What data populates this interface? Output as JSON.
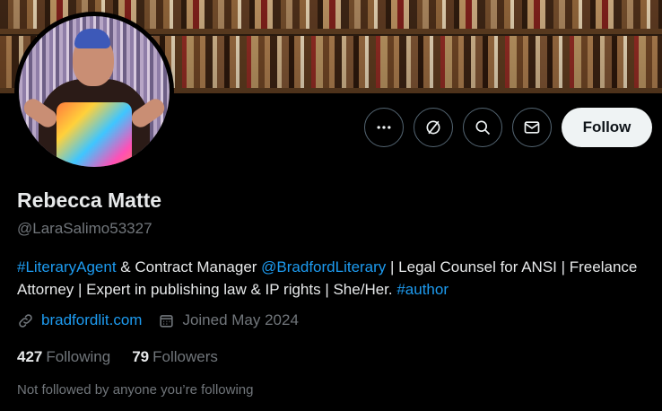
{
  "profile": {
    "name": "Rebecca Matte",
    "handle": "@LaraSalimo53327",
    "bio": {
      "tag1": "#LiteraryAgent",
      "text1": " & Contract Manager ",
      "mention": "@BradfordLiterary",
      "text2": " | Legal Counsel for ANSI | Freelance Attorney | Expert in publishing law & IP rights | She/Her. ",
      "tag2": "#author"
    },
    "website": "bradfordlit.com",
    "joined": "Joined May 2024",
    "following_count": "427",
    "following_label": "Following",
    "followers_count": "79",
    "followers_label": "Followers",
    "not_followed_text": "Not followed by anyone you’re following"
  },
  "actions": {
    "more_icon": "more-horizontal-icon",
    "grok_icon": "grok-icon",
    "search_icon": "search-icon",
    "message_icon": "mail-icon",
    "follow_label": "Follow"
  },
  "colors": {
    "background": "#000000",
    "link": "#1d9bf0",
    "secondary_text": "#71767b",
    "follow_bg": "#eff3f4"
  }
}
